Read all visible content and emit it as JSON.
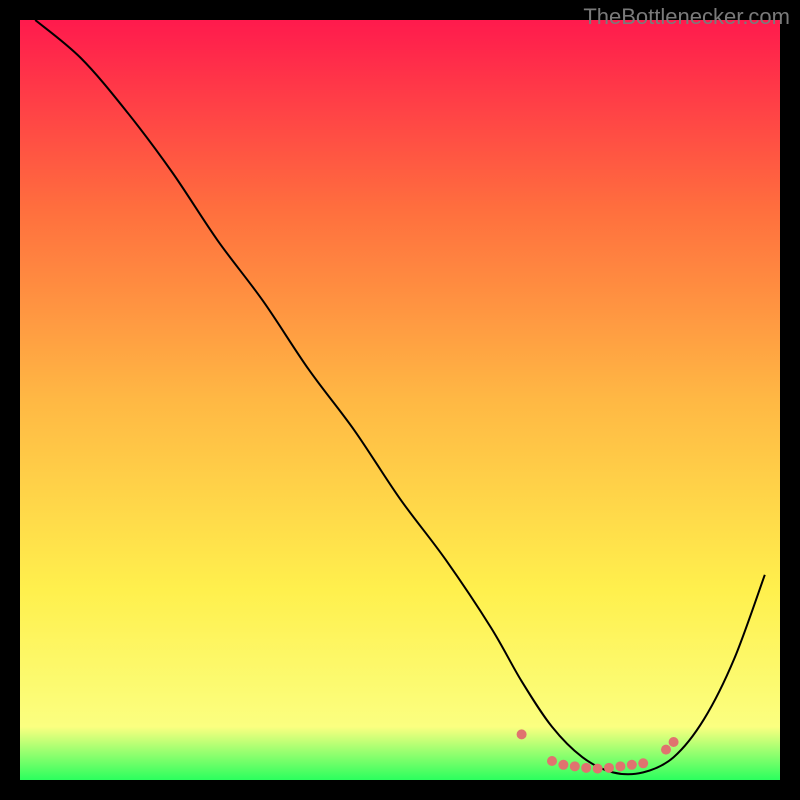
{
  "watermark": "TheBottlenecker.com",
  "chart_data": {
    "type": "line",
    "title": "",
    "xlabel": "",
    "ylabel": "",
    "xlim": [
      0,
      100
    ],
    "ylim": [
      0,
      100
    ],
    "grid": false,
    "background_gradient": {
      "stops": [
        {
          "offset": 0,
          "color": "#ff1a4d"
        },
        {
          "offset": 25,
          "color": "#ff6f3e"
        },
        {
          "offset": 50,
          "color": "#ffb844"
        },
        {
          "offset": 75,
          "color": "#fff04d"
        },
        {
          "offset": 93,
          "color": "#fbff80"
        },
        {
          "offset": 100,
          "color": "#2bff5e"
        }
      ]
    },
    "series": [
      {
        "name": "bottleneck-curve",
        "color": "#000000",
        "width": 2,
        "x": [
          2,
          8,
          14,
          20,
          26,
          32,
          38,
          44,
          50,
          56,
          62,
          66,
          70,
          74,
          78,
          82,
          86,
          90,
          94,
          98
        ],
        "y": [
          100,
          95,
          88,
          80,
          71,
          63,
          54,
          46,
          37,
          29,
          20,
          13,
          7,
          3,
          1,
          1,
          3,
          8,
          16,
          27
        ]
      }
    ],
    "markers": {
      "name": "valley-markers",
      "color": "#e0736f",
      "radius": 5,
      "x": [
        66,
        70,
        71.5,
        73,
        74.5,
        76,
        77.5,
        79,
        80.5,
        82,
        85,
        86
      ],
      "y": [
        6,
        2.5,
        2,
        1.8,
        1.6,
        1.5,
        1.6,
        1.8,
        2,
        2.2,
        4,
        5
      ]
    }
  }
}
